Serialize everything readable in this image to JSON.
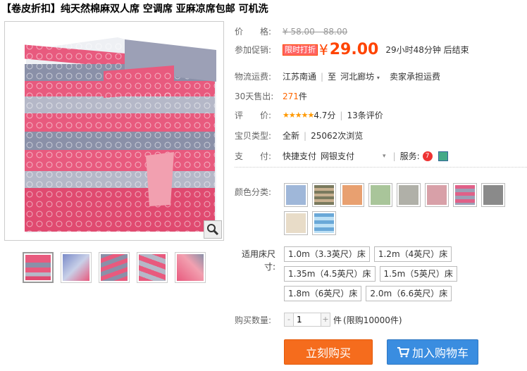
{
  "title": "【卷皮折扣】纯天然棉麻双人席 空调席 亚麻凉席包邮 可机洗",
  "price": {
    "label": "价　　格:",
    "original": "¥ 58.00 - 88.00",
    "promo_label": "参加促销:",
    "promo_tag": "限时打折",
    "yen": "¥",
    "current": "29.00",
    "countdown": "29小时48分钟 后结束"
  },
  "shipping": {
    "label": "物流运费:",
    "from": "江苏南通",
    "to_prefix": "至",
    "to": "河北廊坊",
    "fee": "卖家承担运费"
  },
  "sold": {
    "label": "30天售出:",
    "count": "271",
    "unit": "件"
  },
  "rating": {
    "label": "评　　价:",
    "stars": "★★★★★",
    "score": "4.7分",
    "reviews": "13条评价"
  },
  "item_type": {
    "label": "宝贝类型:",
    "condition": "全新",
    "views": "25062次浏览"
  },
  "payment": {
    "label": "支　　付:",
    "methods": [
      "快捷支付",
      "网银支付"
    ],
    "service_label": "服务:"
  },
  "color": {
    "label": "颜色分类:",
    "swatches": [
      {
        "icon": "swatch-blue-floral",
        "color": "#9fb7d9"
      },
      {
        "icon": "swatch-stripe-dark",
        "color": "#7a7a5e"
      },
      {
        "icon": "swatch-orange-floral",
        "color": "#e8a070"
      },
      {
        "icon": "swatch-green-floral",
        "color": "#a9c59a"
      },
      {
        "icon": "swatch-grey-floral",
        "color": "#b0b0a8"
      },
      {
        "icon": "swatch-pink-floral",
        "color": "#d8a0a8"
      },
      {
        "icon": "swatch-pink-grey-stripe",
        "color": "#e06088"
      },
      {
        "icon": "swatch-grey-red",
        "color": "#8a8a8a"
      },
      {
        "icon": "swatch-cream-floral",
        "color": "#e8dcc8"
      },
      {
        "icon": "swatch-blue-stripe",
        "color": "#6aa8d8"
      }
    ]
  },
  "size": {
    "label": "适用床尺寸:",
    "options": [
      "1.0m（3.3英尺）床",
      "1.2m（4英尺）床",
      "1.35m（4.5英尺）床",
      "1.5m（5英尺）床",
      "1.8m（6英尺）床",
      "2.0m（6.6英尺）床"
    ]
  },
  "quantity": {
    "label": "购买数量:",
    "minus": "-",
    "value": "1",
    "plus": "+",
    "unit": "件",
    "limit": "(限购10000件)"
  },
  "actions": {
    "buy": "立刻购买",
    "cart": "加入购物车"
  },
  "colors": {
    "accent": "#ff4400",
    "buy_button": "#f56c1d",
    "cart_button": "#3a8de0",
    "pink": "#e85a7e",
    "grey": "#8a90a8"
  }
}
